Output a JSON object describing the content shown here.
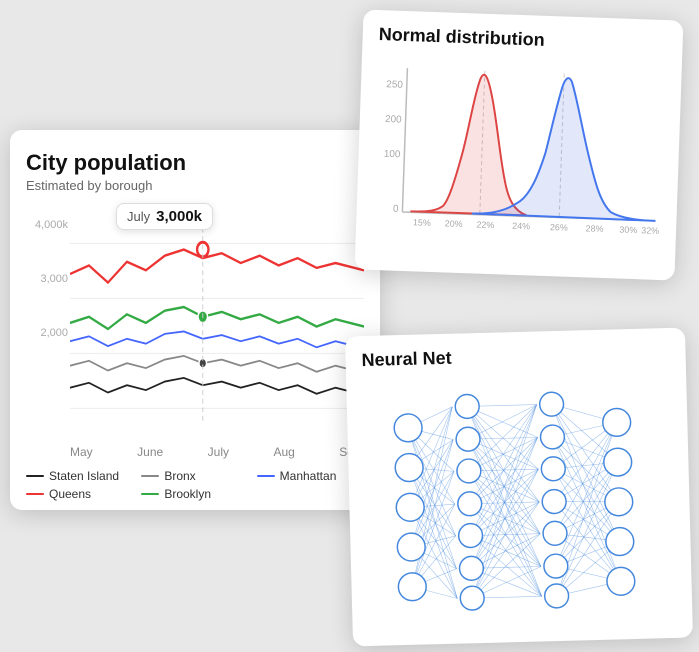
{
  "population_card": {
    "title": "City population",
    "subtitle": "Estimated by borough",
    "tooltip_month": "July",
    "tooltip_value": "3,000k",
    "x_labels": [
      "May",
      "June",
      "July",
      "Aug",
      "Sept"
    ],
    "y_labels": [
      "4,000k",
      "3,000",
      "2,000"
    ],
    "legend": [
      {
        "label": "Staten Island",
        "color": "#222222"
      },
      {
        "label": "Bronx",
        "color": "#888888"
      },
      {
        "label": "Manhattan",
        "color": "#4466ff"
      },
      {
        "label": "Queens",
        "color": "#ee3333"
      },
      {
        "label": "Brooklyn",
        "color": "#33aa44"
      }
    ]
  },
  "normal_card": {
    "title": "Normal distribution"
  },
  "neural_card": {
    "title": "Neural Net"
  }
}
